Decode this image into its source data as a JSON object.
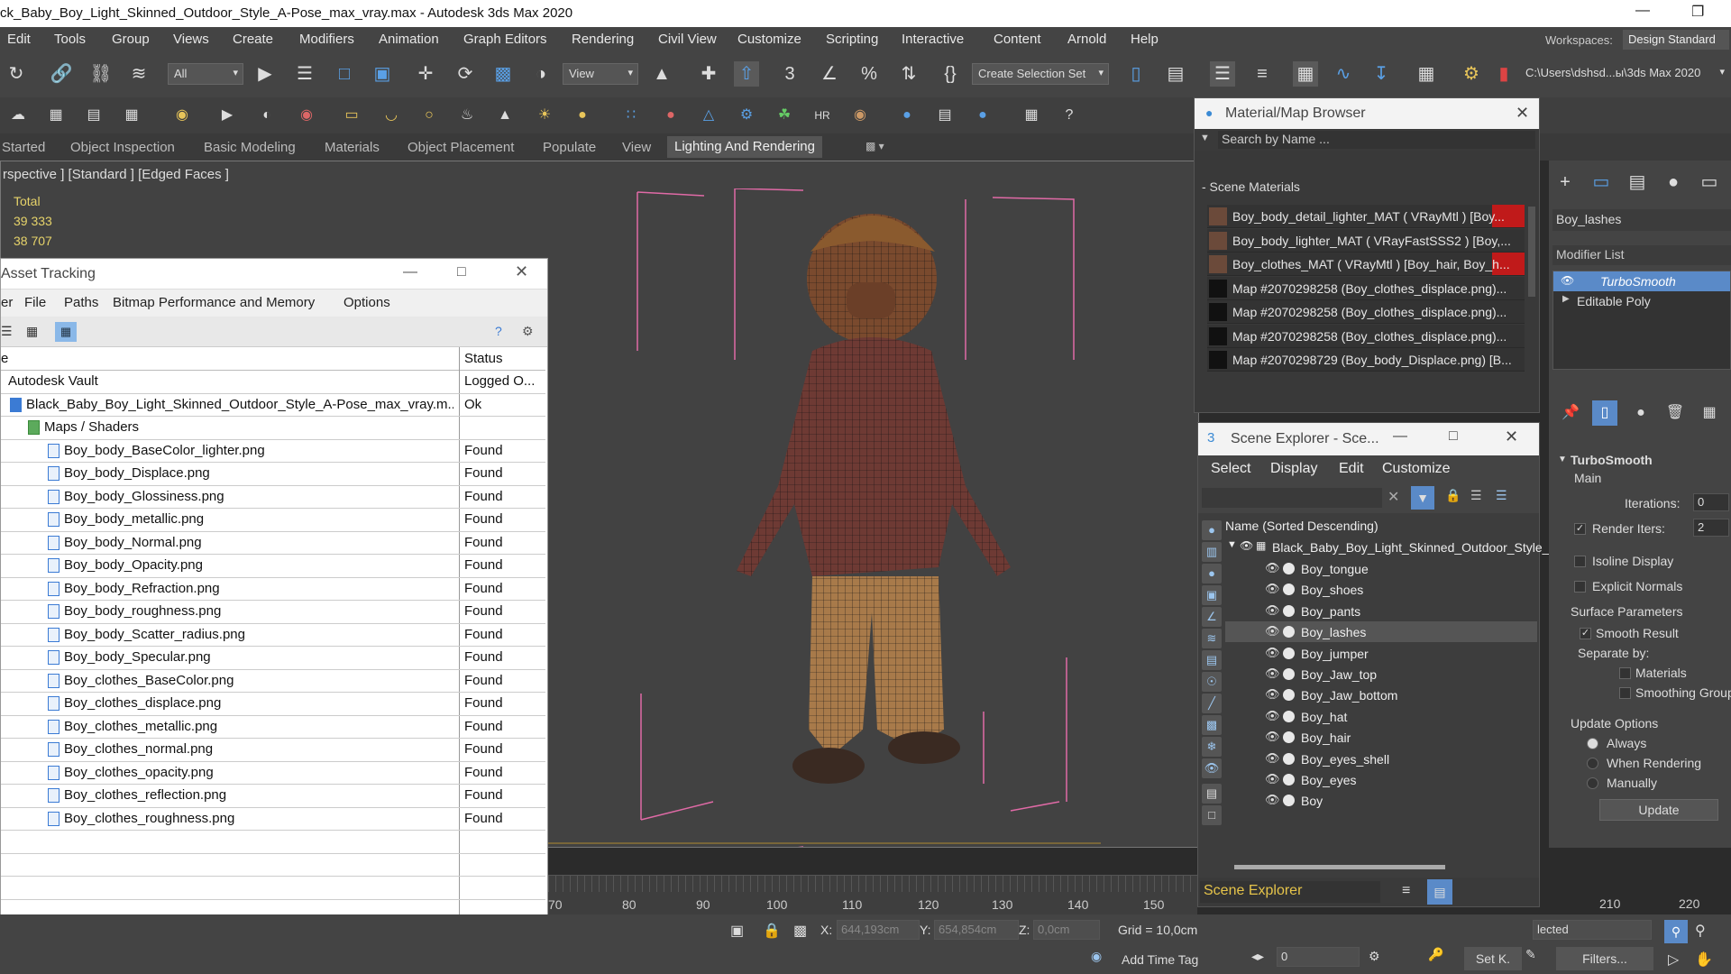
{
  "titlebar": {
    "title": "ck_Baby_Boy_Light_Skinned_Outdoor_Style_A-Pose_max_vray.max - Autodesk 3ds Max 2020",
    "min_icon": "minimize-icon",
    "max_icon": "maximize-icon"
  },
  "menubar": {
    "items": [
      "Edit",
      "Tools",
      "Group",
      "Views",
      "Create",
      "Modifiers",
      "Animation",
      "Graph Editors",
      "Rendering",
      "Civil View",
      "Customize",
      "Scripting",
      "Interactive",
      "Content",
      "Arnold",
      "Help"
    ],
    "workspaces_label": "Workspaces:",
    "workspace_value": "Design Standard"
  },
  "toolbar": {
    "filter_all": "All",
    "view_dropdown": "View",
    "selection_set": "Create Selection Set",
    "path": "C:\\Users\\dshsd...ы\\3ds Max 2020"
  },
  "ribbon": {
    "tabs": [
      "Started",
      "Object Inspection",
      "Basic Modeling",
      "Materials",
      "Object Placement",
      "Populate",
      "View",
      "Lighting And Rendering"
    ],
    "active": "Lighting And Rendering"
  },
  "viewport": {
    "label": "rspective ] [Standard ] [Edged Faces ]",
    "stats_label": "Total",
    "stat1": "39 333",
    "stat2": "38 707"
  },
  "asset_tracking": {
    "title": "Asset Tracking",
    "menu": [
      "er",
      "File",
      "Paths",
      "Bitmap Performance and Memory",
      "Options"
    ],
    "col_name": "e",
    "col_status": "Status",
    "rows": [
      {
        "name": "Autodesk Vault",
        "status": "Logged O..."
      },
      {
        "name": "Black_Baby_Boy_Light_Skinned_Outdoor_Style_A-Pose_max_vray.m...",
        "status": "Ok"
      },
      {
        "name": "Maps / Shaders",
        "status": ""
      },
      {
        "name": "Boy_body_BaseColor_lighter.png",
        "status": "Found"
      },
      {
        "name": "Boy_body_Displace.png",
        "status": "Found"
      },
      {
        "name": "Boy_body_Glossiness.png",
        "status": "Found"
      },
      {
        "name": "Boy_body_metallic.png",
        "status": "Found"
      },
      {
        "name": "Boy_body_Normal.png",
        "status": "Found"
      },
      {
        "name": "Boy_body_Opacity.png",
        "status": "Found"
      },
      {
        "name": "Boy_body_Refraction.png",
        "status": "Found"
      },
      {
        "name": "Boy_body_roughness.png",
        "status": "Found"
      },
      {
        "name": "Boy_body_Scatter_radius.png",
        "status": "Found"
      },
      {
        "name": "Boy_body_Specular.png",
        "status": "Found"
      },
      {
        "name": "Boy_clothes_BaseColor.png",
        "status": "Found"
      },
      {
        "name": "Boy_clothes_displace.png",
        "status": "Found"
      },
      {
        "name": "Boy_clothes_metallic.png",
        "status": "Found"
      },
      {
        "name": "Boy_clothes_normal.png",
        "status": "Found"
      },
      {
        "name": "Boy_clothes_opacity.png",
        "status": "Found"
      },
      {
        "name": "Boy_clothes_reflection.png",
        "status": "Found"
      },
      {
        "name": "Boy_clothes_roughness.png",
        "status": "Found"
      }
    ]
  },
  "material_browser": {
    "title": "Material/Map Browser",
    "search_placeholder": "Search by Name ...",
    "section": "- Scene Materials",
    "items": [
      {
        "label": "Boy_body_detail_lighter_MAT  ( VRayMtl )  [Boy...",
        "flag": true
      },
      {
        "label": "Boy_body_lighter_MAT  ( VRayFastSSS2 )  [Boy,...",
        "flag": false
      },
      {
        "label": "Boy_clothes_MAT  ( VRayMtl )  [Boy_hair, Boy_h...",
        "flag": true
      },
      {
        "label": "Map  #2070298258  (Boy_clothes_displace.png)...",
        "flag": false
      },
      {
        "label": "Map  #2070298258  (Boy_clothes_displace.png)...",
        "flag": false
      },
      {
        "label": "Map  #2070298258  (Boy_clothes_displace.png)...",
        "flag": false
      },
      {
        "label": "Map  #2070298729  (Boy_body_Displace.png)  [B...",
        "flag": false
      }
    ]
  },
  "scene_explorer": {
    "title": "Scene Explorer - Sce...",
    "menu": [
      "Select",
      "Display",
      "Edit",
      "Customize"
    ],
    "col_header": "Name (Sorted Descending)",
    "root": "Black_Baby_Boy_Light_Skinned_Outdoor_Style_",
    "items": [
      "Boy_tongue",
      "Boy_shoes",
      "Boy_pants",
      "Boy_lashes",
      "Boy_jumper",
      "Boy_Jaw_top",
      "Boy_Jaw_bottom",
      "Boy_hat",
      "Boy_hair",
      "Boy_eyes_shell",
      "Boy_eyes",
      "Boy"
    ],
    "selected": "Boy_lashes",
    "footer_name": "Scene Explorer"
  },
  "command_panel": {
    "object_name": "Boy_lashes",
    "modifier_list": "Modifier List",
    "stack": [
      "TurboSmooth",
      "Editable Poly"
    ],
    "rollout_title": "TurboSmooth",
    "main_label": "Main",
    "iterations_label": "Iterations:",
    "iterations_value": "0",
    "render_iters_label": "Render Iters:",
    "render_iters_value": "2",
    "isoline": "Isoline Display",
    "explicit_normals": "Explicit Normals",
    "surface_params": "Surface Parameters",
    "smooth_result": "Smooth Result",
    "separate_by": "Separate by:",
    "materials": "Materials",
    "smoothing_groups": "Smoothing Groups",
    "update_options": "Update Options",
    "always": "Always",
    "when_rendering": "When Rendering",
    "manually": "Manually",
    "update_btn": "Update"
  },
  "timeline": {
    "ticks": [
      "70",
      "80",
      "90",
      "100",
      "110",
      "120",
      "130",
      "140",
      "150",
      "210",
      "220"
    ]
  },
  "statusbar": {
    "x_label": "X:",
    "x_value": "644,193cm",
    "y_label": "Y:",
    "y_value": "654,854cm",
    "z_label": "Z:",
    "z_value": "0,0cm",
    "grid": "Grid = 10,0cm",
    "add_time_tag": "Add Time Tag",
    "frame_value": "0",
    "set_key": "Set K.",
    "filters": "Filters...",
    "selected_dd": "lected"
  }
}
